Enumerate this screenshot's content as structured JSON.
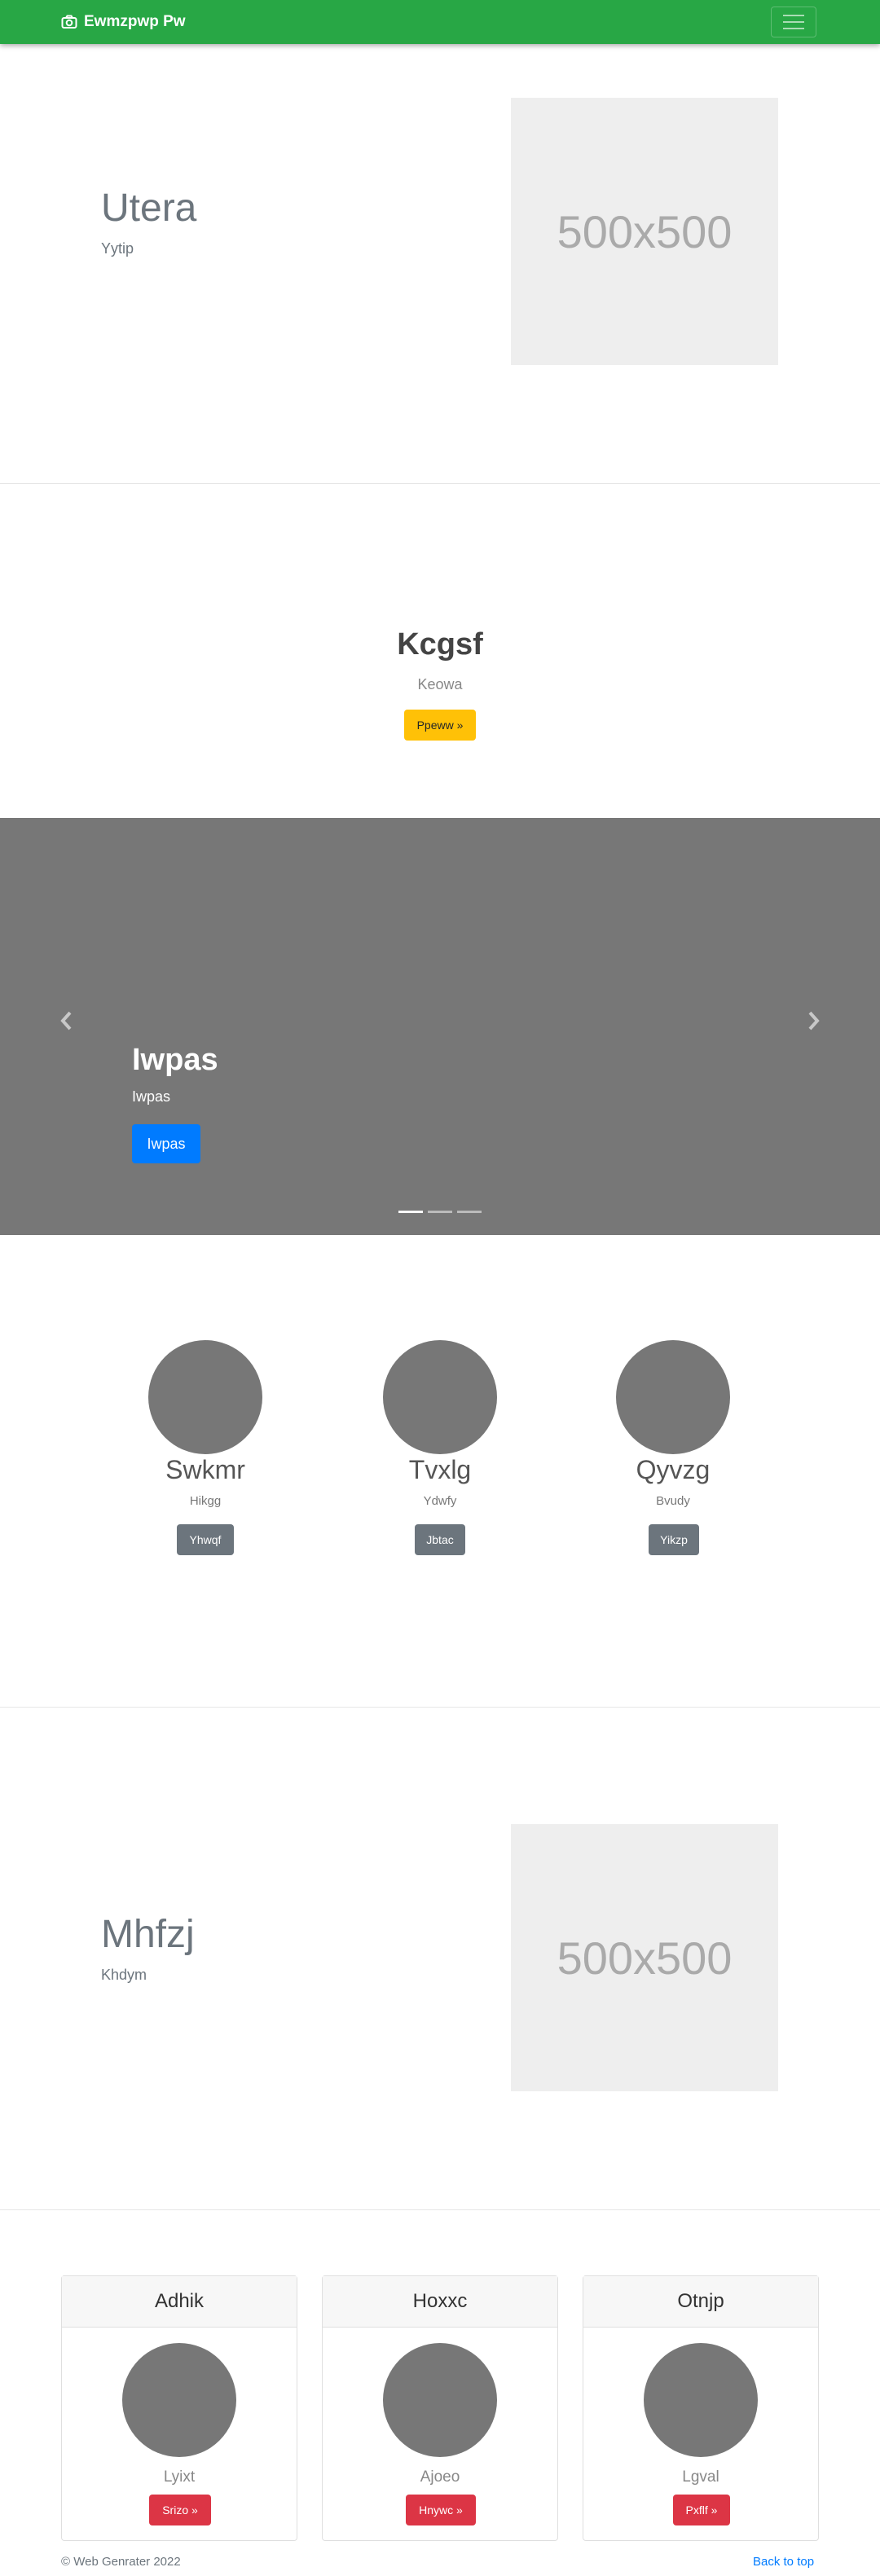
{
  "navbar": {
    "brand": "Ewmzpwp Pw",
    "brand_icon": "camera-icon",
    "toggle_icon": "hamburger-icon",
    "color": "#28a745"
  },
  "feature1": {
    "title": "Utera",
    "subtitle": "Yytip",
    "image_text": "500x500"
  },
  "jumbotron": {
    "title": "Kcgsf",
    "subtitle": "Keowa",
    "button": "Ppeww »"
  },
  "carousel": {
    "title": "Iwpas",
    "subtitle": "Iwpas",
    "button": "Iwpas",
    "prev_icon": "chevron-left-icon",
    "next_icon": "chevron-right-icon",
    "slides": 3,
    "active": 1
  },
  "marketing": [
    {
      "title": "Swkmr",
      "subtitle": "Hikgg",
      "button": "Yhwqf"
    },
    {
      "title": "Tvxlg",
      "subtitle": "Ydwfy",
      "button": "Jbtac"
    },
    {
      "title": "Qyvzg",
      "subtitle": "Bvudy",
      "button": "Yikzp"
    }
  ],
  "feature2": {
    "title": "Mhfzj",
    "subtitle": "Khdym",
    "image_text": "500x500"
  },
  "cards": [
    {
      "header": "Adhik",
      "text": "Lyixt",
      "button": "Srizo »"
    },
    {
      "header": "Hoxxc",
      "text": "Ajoeo",
      "button": "Hnywc »"
    },
    {
      "header": "Otnjp",
      "text": "Lgval",
      "button": "Pxflf »"
    }
  ],
  "footer": {
    "copyright": "© Web Genrater 2022",
    "back_to_top": "Back to top"
  }
}
